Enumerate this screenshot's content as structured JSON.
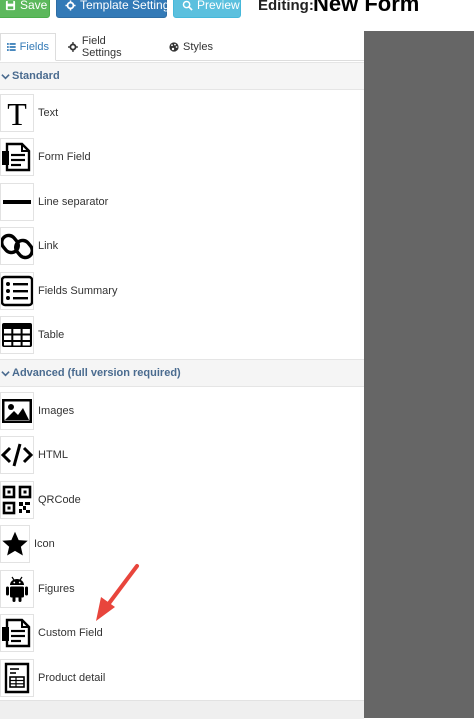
{
  "toolbar": {
    "save_label": "Save",
    "template_settings_label": "Template Settings",
    "preview_label": "Preview",
    "editing_label": "Editing:",
    "form_title": "New Form"
  },
  "tabs": [
    {
      "label": "Fields",
      "icon": "list-icon",
      "active": true
    },
    {
      "label": "Field Settings",
      "icon": "gear-icon",
      "active": false
    },
    {
      "label": "Styles",
      "icon": "palette-icon",
      "active": false
    }
  ],
  "sections": {
    "standard": {
      "title": "Standard",
      "items": [
        {
          "label": "Text",
          "icon": "text-t-icon"
        },
        {
          "label": "Form Field",
          "icon": "document-icon"
        },
        {
          "label": "Line separator",
          "icon": "horizontal-line-icon"
        },
        {
          "label": "Link",
          "icon": "chain-link-icon"
        },
        {
          "label": "Fields Summary",
          "icon": "bulleted-list-icon"
        },
        {
          "label": "Table",
          "icon": "table-grid-icon"
        }
      ]
    },
    "advanced": {
      "title": "Advanced (full version required)",
      "items": [
        {
          "label": "Images",
          "icon": "image-icon"
        },
        {
          "label": "HTML",
          "icon": "code-icon"
        },
        {
          "label": "QRCode",
          "icon": "qrcode-icon"
        },
        {
          "label": "Icon",
          "icon": "star-icon"
        },
        {
          "label": "Figures",
          "icon": "android-icon"
        },
        {
          "label": "Custom Field",
          "icon": "document-icon"
        },
        {
          "label": "Product detail",
          "icon": "invoice-icon"
        }
      ]
    }
  },
  "colors": {
    "save": "#5cb85c",
    "template_settings": "#337ab7",
    "preview": "#5bc0de",
    "section_header_text": "#4a6b8f",
    "canvas": "#666666",
    "annotation_arrow": "#e8453c"
  }
}
